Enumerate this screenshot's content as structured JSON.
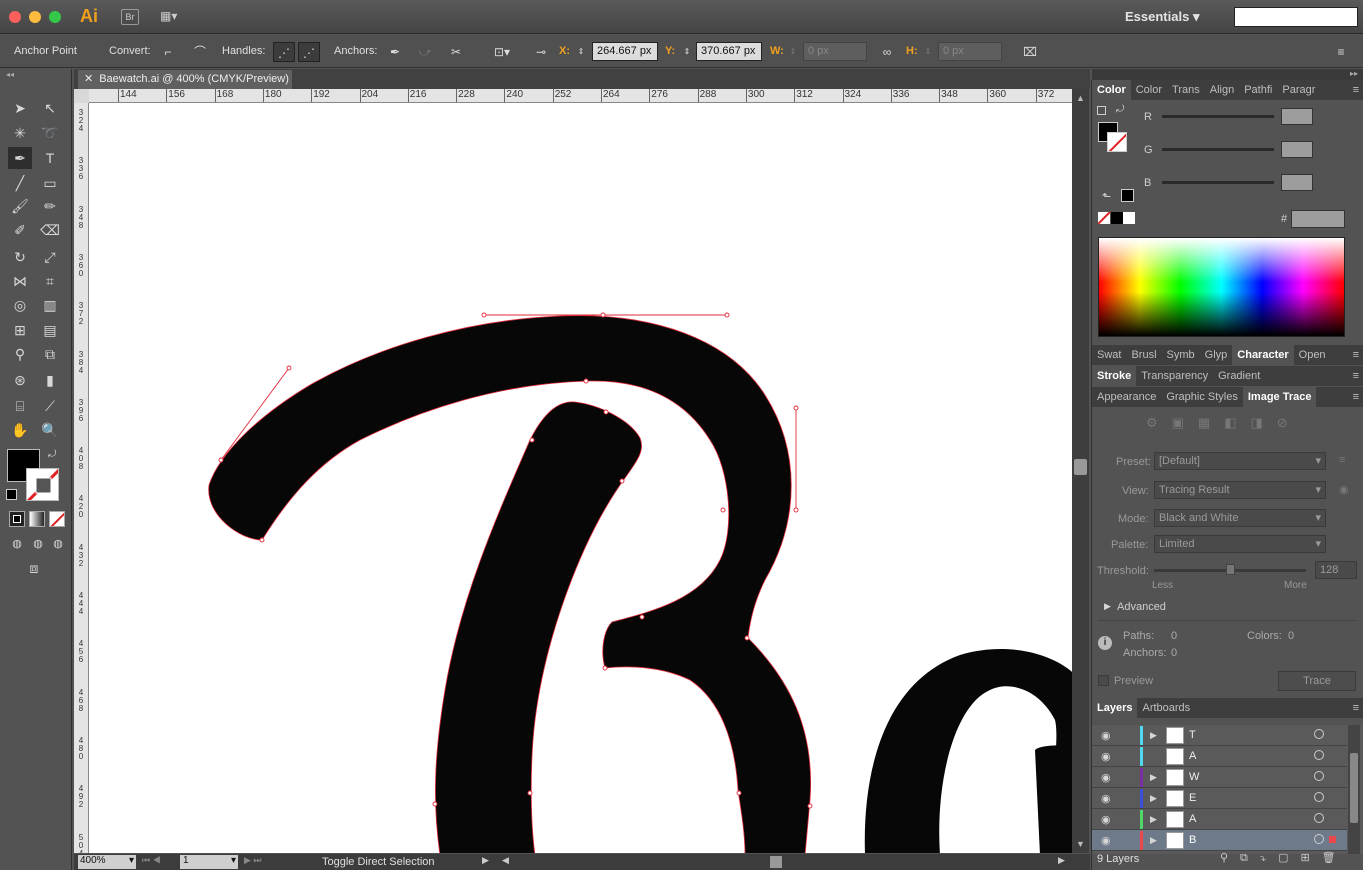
{
  "app": {
    "logo": "Ai",
    "bridge": "Br",
    "workspace": "Essentials"
  },
  "control_bar": {
    "tool_name": "Anchor Point",
    "convert_label": "Convert:",
    "handles_label": "Handles:",
    "anchors_label": "Anchors:",
    "x_label": "X:",
    "x_value": "264.667 px",
    "y_label": "Y:",
    "y_value": "370.667 px",
    "w_label": "W:",
    "w_value": "0 px",
    "h_label": "H:",
    "h_value": "0 px"
  },
  "document": {
    "tab_title": "Baewatch.ai @ 400% (CMYK/Preview)"
  },
  "ruler": {
    "h_ticks": [
      "144",
      "156",
      "168",
      "180",
      "192",
      "204",
      "216",
      "228",
      "240",
      "252",
      "264",
      "276",
      "288",
      "300",
      "312",
      "324",
      "336",
      "348",
      "360",
      "372"
    ],
    "v_ticks": [
      "3\n2\n4",
      "3\n3\n6",
      "3\n4\n8",
      "3\n6\n0",
      "3\n7\n2",
      "3\n8\n4",
      "3\n9\n6",
      "4\n0\n8",
      "4\n2\n0",
      "4\n3\n2",
      "4\n4\n4",
      "4\n5\n6",
      "4\n6\n8",
      "4\n8\n0",
      "4\n9\n2",
      "5\n0\n4"
    ]
  },
  "status": {
    "zoom": "400%",
    "artboard": "1",
    "message": "Toggle Direct Selection"
  },
  "color_panel": {
    "tabs": [
      "Color",
      "Color",
      "Trans",
      "Align",
      "Pathfi",
      "Paragr"
    ],
    "channels": [
      "R",
      "G",
      "B"
    ],
    "hash": "#"
  },
  "panel_tabs_row2": [
    "Swat",
    "Brusl",
    "Symb",
    "Glyp",
    "Character",
    "Open"
  ],
  "panel_tabs_row3": [
    "Stroke",
    "Transparency",
    "Gradient"
  ],
  "panel_tabs_row4": [
    "Appearance",
    "Graphic Styles",
    "Image Trace"
  ],
  "image_trace": {
    "preset_label": "Preset:",
    "preset_value": "[Default]",
    "view_label": "View:",
    "view_value": "Tracing Result",
    "mode_label": "Mode:",
    "mode_value": "Black and White",
    "palette_label": "Palette:",
    "palette_value": "Limited",
    "threshold_label": "Threshold:",
    "threshold_value": "128",
    "less": "Less",
    "more": "More",
    "advanced": "Advanced",
    "paths_label": "Paths:",
    "paths_value": "0",
    "colors_label": "Colors:",
    "colors_value": "0",
    "anchors_label": "Anchors:",
    "anchors_value": "0",
    "preview_label": "Preview",
    "trace_button": "Trace"
  },
  "layers_panel": {
    "tabs": [
      "Layers",
      "Artboards"
    ],
    "layers": [
      {
        "name": "T",
        "color": "#4fd8ef"
      },
      {
        "name": "A",
        "color": "#4fd8ef"
      },
      {
        "name": "W",
        "color": "#7b2fa0"
      },
      {
        "name": "E",
        "color": "#3b4fd8"
      },
      {
        "name": "A",
        "color": "#4fd86a"
      },
      {
        "name": "B",
        "color": "#e8474c"
      }
    ],
    "count": "9 Layers"
  }
}
